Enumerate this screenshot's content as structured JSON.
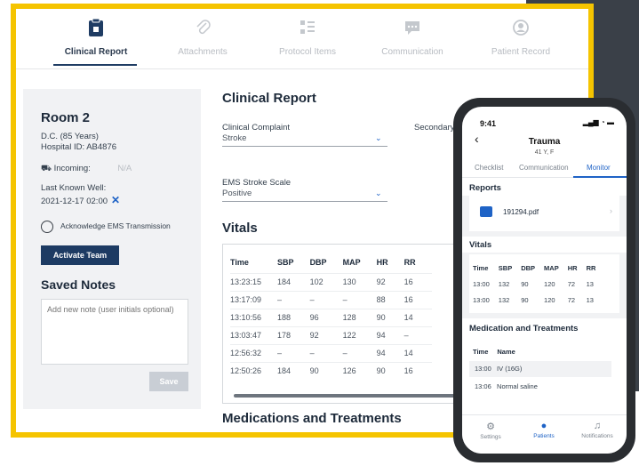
{
  "tabs": [
    {
      "label": "Clinical Report",
      "icon": "clipboard-icon",
      "active": true
    },
    {
      "label": "Attachments",
      "icon": "paperclip-icon",
      "active": false
    },
    {
      "label": "Protocol Items",
      "icon": "checklist-icon",
      "active": false
    },
    {
      "label": "Communication",
      "icon": "chat-icon",
      "active": false
    },
    {
      "label": "Patient Record",
      "icon": "user-circle-icon",
      "active": false
    }
  ],
  "patient": {
    "room": "Room 2",
    "name_age": "D.C. (85 Years)",
    "hospital_id": "Hospital ID: AB4876",
    "incoming_label": "Incoming:",
    "incoming_value": "N/A",
    "last_known_well_label": "Last Known Well:",
    "last_known_well_value": "2021-12-17 02:00",
    "acknowledge_label": "Acknowledge EMS Transmission",
    "activate_button": "Activate Team"
  },
  "notes": {
    "title": "Saved Notes",
    "placeholder": "Add new note (user initials optional)",
    "save_button": "Save"
  },
  "report": {
    "title": "Clinical Report",
    "complaint_label": "Clinical Complaint",
    "complaint_value": "Stroke",
    "secondary_label": "Secondary C",
    "ems_scale_label": "EMS Stroke Scale",
    "ems_scale_value": "Positive"
  },
  "vitals": {
    "title": "Vitals",
    "columns": [
      "Time",
      "SBP",
      "DBP",
      "MAP",
      "HR",
      "RR"
    ],
    "rows": [
      [
        "13:23:15",
        "184",
        "102",
        "130",
        "92",
        "16"
      ],
      [
        "13:17:09",
        "–",
        "–",
        "–",
        "88",
        "16"
      ],
      [
        "13:10:56",
        "188",
        "96",
        "128",
        "90",
        "14"
      ],
      [
        "13:03:47",
        "178",
        "92",
        "122",
        "94",
        "–"
      ],
      [
        "12:56:32",
        "–",
        "–",
        "–",
        "94",
        "14"
      ],
      [
        "12:50:26",
        "184",
        "90",
        "126",
        "90",
        "16"
      ]
    ]
  },
  "medications_title": "Medications and Treatments",
  "phone": {
    "time": "9:41",
    "title": "Trauma",
    "subtitle": "41 Y, F",
    "tabs": [
      "Checklist",
      "Communication",
      "Monitor"
    ],
    "reports_title": "Reports",
    "pdf_name": "191294.pdf",
    "vitals_title": "Vitals",
    "vitals_columns": [
      "Time",
      "SBP",
      "DBP",
      "MAP",
      "HR",
      "RR"
    ],
    "vitals_rows": [
      [
        "13:00",
        "132",
        "90",
        "120",
        "72",
        "13"
      ],
      [
        "13:00",
        "132",
        "90",
        "120",
        "72",
        "13"
      ]
    ],
    "meds_title": "Medication and Treatments",
    "meds_columns": [
      "Time",
      "Name"
    ],
    "meds_rows": [
      [
        "13:00",
        "IV (16G)"
      ],
      [
        "13:06",
        "Normal saline"
      ]
    ],
    "bottom_nav": [
      {
        "label": "Settings",
        "icon": "gear-icon"
      },
      {
        "label": "Patients",
        "icon": "user-circle-icon"
      },
      {
        "label": "Notifications",
        "icon": "bell-icon"
      }
    ]
  },
  "colors": {
    "accent_yellow": "#f5c400",
    "primary_navy": "#1d3b63",
    "link_blue": "#1f63c6"
  }
}
